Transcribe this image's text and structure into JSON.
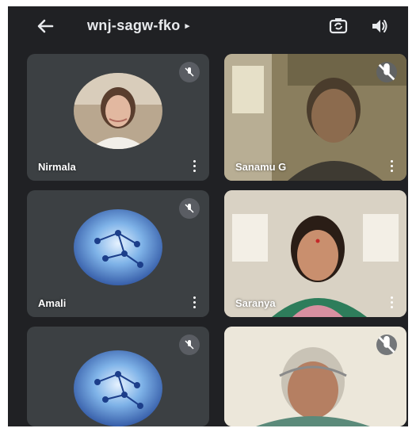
{
  "header": {
    "meeting_code": "wnj-sagw-fko",
    "caret": "▸"
  },
  "participants": [
    {
      "name": "Nirmala",
      "video": false,
      "muted": true
    },
    {
      "name": "Sanamu G",
      "video": true,
      "muted": true
    },
    {
      "name": "Amali",
      "video": false,
      "muted": true
    },
    {
      "name": "Saranya",
      "video": true,
      "muted": false
    },
    {
      "name": "",
      "video": false,
      "muted": true
    },
    {
      "name": "",
      "video": true,
      "muted": true
    }
  ],
  "colors": {
    "background": "#202124",
    "tile": "#3c4043",
    "text": "#e8eaed"
  }
}
